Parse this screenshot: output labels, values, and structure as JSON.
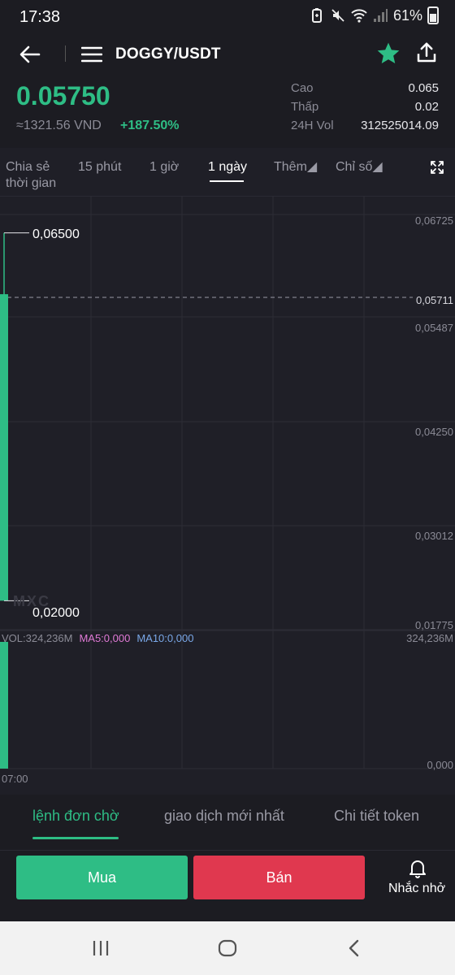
{
  "status_bar": {
    "time": "17:38",
    "battery": "61%",
    "icons": [
      "battery-saver-icon",
      "mute-icon",
      "wifi-icon",
      "signal-icon",
      "battery-icon"
    ]
  },
  "header": {
    "pair": "DOGGY/USDT",
    "icons": [
      "back-arrow-icon",
      "menu-icon",
      "star-icon",
      "share-icon"
    ],
    "favorite_color": "#2ebd85"
  },
  "ticker": {
    "last_price": "0.05750",
    "fiat_price": "≈1321.56 VND",
    "change_pct": "+187.50%",
    "stats": [
      {
        "label": "Cao",
        "value": "0.065"
      },
      {
        "label": "Thấp",
        "value": "0.02"
      },
      {
        "label": "24H Vol",
        "value": "312525014.09"
      }
    ]
  },
  "intervals": {
    "tabs": [
      {
        "label": "Chia sẻ\nthời gian"
      },
      {
        "label": "15 phút"
      },
      {
        "label": "1 giờ"
      },
      {
        "label": "1 ngày",
        "active": true
      },
      {
        "label": "Thêm◢"
      },
      {
        "label": "Chỉ số◢"
      }
    ]
  },
  "chart": {
    "y_labels": [
      "0,06725",
      "0,05711",
      "0,05487",
      "0,04250",
      "0,03012",
      "0,01775"
    ],
    "high_callout": "0,06500",
    "low_callout": "0,02000",
    "watermark": "MXC",
    "volume": {
      "label": "VOL:324,236M",
      "ma5": "MA5:0,000",
      "ma10": "MA10:0,000",
      "max": "324,236M",
      "zero": "0,000"
    },
    "time_label": "07:00"
  },
  "chart_data": {
    "type": "candlestick",
    "candles": [
      {
        "time": "07:00",
        "open": 0.02,
        "high": 0.065,
        "low": 0.02,
        "close": 0.0575,
        "volume_m": 324.236
      }
    ],
    "current_price_line": 0.05711,
    "ylim": [
      0.01775,
      0.06725
    ],
    "colors": {
      "up": "#2ebd85",
      "down": "#e0384f"
    }
  },
  "bottom_tabs": [
    {
      "label": "lệnh đơn chờ",
      "active": true
    },
    {
      "label": "giao dịch mới nhất"
    },
    {
      "label": "Chi tiết token"
    }
  ],
  "actions": {
    "buy": "Mua",
    "sell": "Bán",
    "alert": "Nhắc nhở"
  },
  "nav": {
    "icons": [
      "recent-apps-icon",
      "home-icon",
      "back-icon"
    ]
  }
}
